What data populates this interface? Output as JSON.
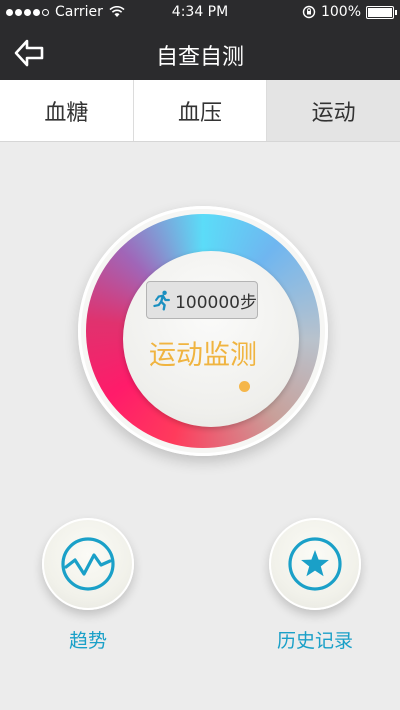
{
  "status_bar": {
    "carrier": "Carrier",
    "time": "4:34 PM",
    "battery": "100%"
  },
  "nav": {
    "title": "自查自测",
    "back_icon": "back-arrow-icon"
  },
  "tabs": [
    {
      "label": "血糖",
      "active": false
    },
    {
      "label": "血压",
      "active": false
    },
    {
      "label": "运动",
      "active": true
    }
  ],
  "monitor": {
    "steps": "100000步",
    "label": "运动监测",
    "icon": "runner-icon"
  },
  "actions": [
    {
      "label": "趋势",
      "icon": "trend-icon"
    },
    {
      "label": "历史记录",
      "icon": "star-icon"
    }
  ],
  "colors": {
    "accent": "#1aa0c8",
    "monitor_text": "#f0b440",
    "ring_start": "#5bdcf8",
    "ring_mid": "#ff1b6a"
  }
}
